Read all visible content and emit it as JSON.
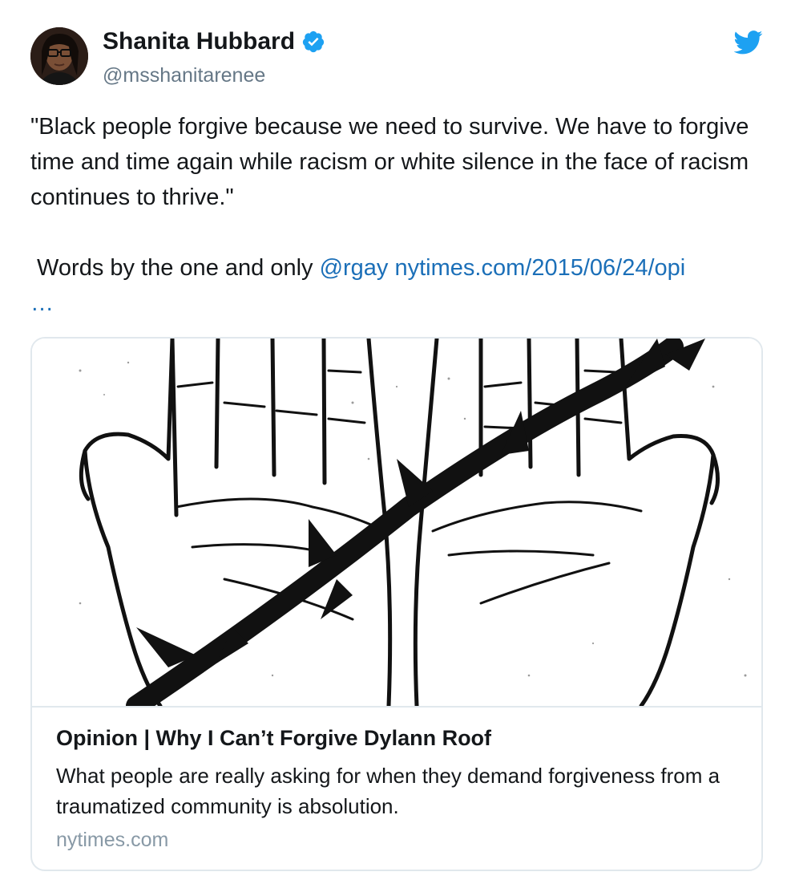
{
  "author": {
    "name": "Shanita Hubbard",
    "handle": "@msshanitarenee",
    "verified": true,
    "avatar_icon": "avatar-photo"
  },
  "platform_icon": "twitter-bird-icon",
  "tweet": {
    "text": "\"Black people forgive because we need to survive. We have to forgive time and time again while racism or white silence in the face of racism continues to thrive.\"",
    "text2_prefix": " Words by the one and only ",
    "mention": "@rgay",
    "url": "nytimes.com/2015/06/24/opi",
    "ellipsis": "…"
  },
  "card": {
    "title": "Opinion | Why I Can’t Forgive Dylann Roof",
    "description": "What people are really asking for when they demand forgiveness from a traumatized community is absolution.",
    "domain": "nytimes.com",
    "image_icon": "open-hands-with-thorny-vine-illustration"
  },
  "colors": {
    "link": "#1b6fb8",
    "twitter_blue": "#1da1f2",
    "secondary_text": "#657786"
  }
}
